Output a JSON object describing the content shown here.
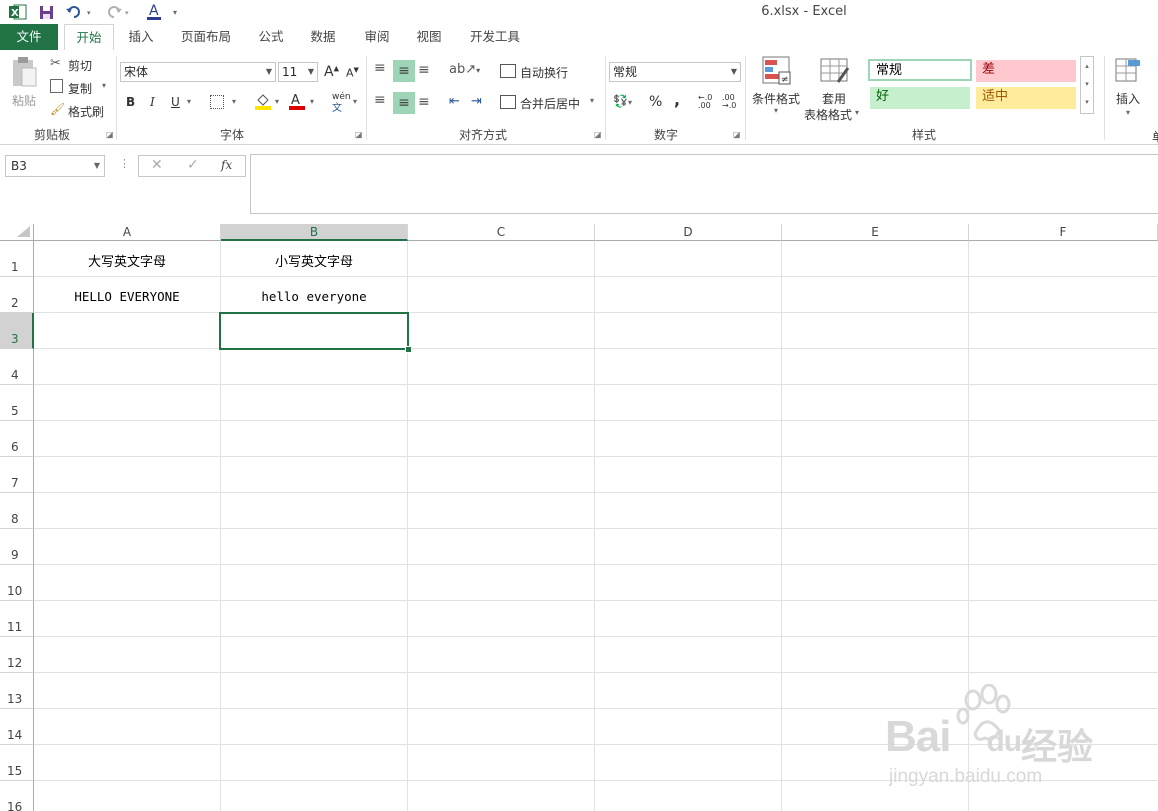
{
  "titlebar": {
    "title": "6.xlsx - Excel"
  },
  "tabs": [
    {
      "label": "文件"
    },
    {
      "label": "开始"
    },
    {
      "label": "插入"
    },
    {
      "label": "页面布局"
    },
    {
      "label": "公式"
    },
    {
      "label": "数据"
    },
    {
      "label": "审阅"
    },
    {
      "label": "视图"
    },
    {
      "label": "开发工具"
    }
  ],
  "ribbon": {
    "clipboard": {
      "paste": "粘贴",
      "cut": "剪切",
      "copy": "复制",
      "format_painter": "格式刷",
      "label": "剪贴板"
    },
    "font": {
      "name": "宋体",
      "size": "11",
      "label": "字体",
      "bold": "B",
      "italic": "I",
      "underline": "U",
      "wen": "wén"
    },
    "alignment": {
      "wrap": "自动换行",
      "merge": "合并后居中",
      "label": "对齐方式"
    },
    "number": {
      "format": "常规",
      "percent": "%",
      "comma": ",",
      "label": "数字"
    },
    "styles": {
      "cond_format": "条件格式",
      "table_format_1": "套用",
      "table_format_2": "表格格式",
      "normal": "常规",
      "bad": "差",
      "good": "好",
      "neutral": "中",
      "neutral_prefix": "适",
      "label": "样式"
    },
    "cells": {
      "insert": "插入",
      "cut_off": "单"
    }
  },
  "formula_bar": {
    "name_box": "B3",
    "fx": "fx",
    "formula": ""
  },
  "columns": [
    "A",
    "B",
    "C",
    "D",
    "E",
    "F"
  ],
  "rows": [
    "1",
    "2",
    "3",
    "4",
    "5",
    "6",
    "7",
    "8",
    "9",
    "10",
    "11",
    "12",
    "13",
    "14",
    "15",
    "16"
  ],
  "cells": {
    "A1": "大写英文字母",
    "B1": "小写英文字母",
    "A2": "HELLO EVERYONE",
    "B2": "hello everyone"
  },
  "selected_cell": "B3",
  "watermark": {
    "brand": "Bai",
    "brand2": "du",
    "cn": "经验",
    "url": "jingyan.baidu.com"
  },
  "colors": {
    "accent": "#217346",
    "bad_fill": "#ffc7ce",
    "bad_text": "#9c0006",
    "good_fill": "#c6efce",
    "good_text": "#006100",
    "neutral_fill": "#ffeb9c",
    "neutral_text": "#9c5700"
  }
}
